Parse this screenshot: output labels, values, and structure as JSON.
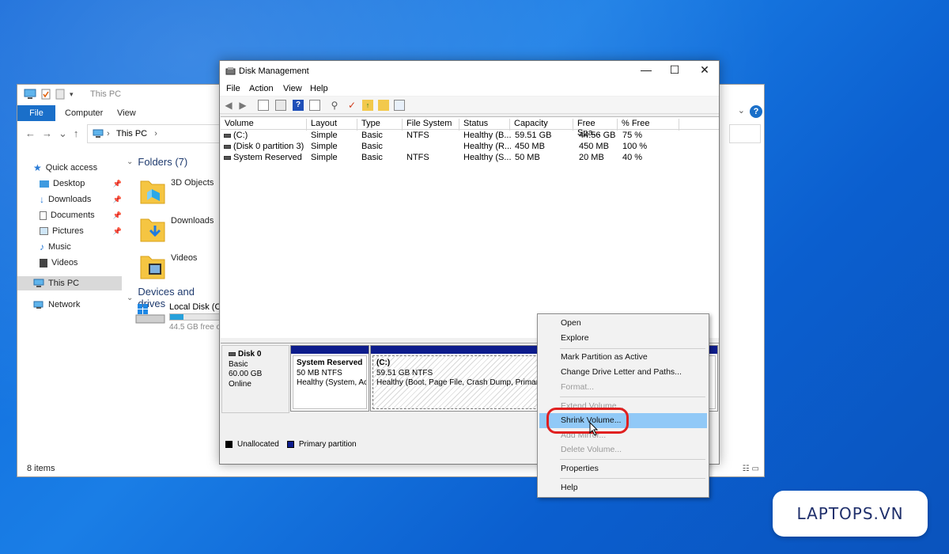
{
  "explorer": {
    "title": "This PC",
    "ribbon_tabs": [
      "File",
      "Computer",
      "View"
    ],
    "address": "This PC",
    "sidebar": [
      {
        "label": "Quick access",
        "icon": "star-icon"
      },
      {
        "label": "Desktop",
        "icon": "desktop-folder-icon"
      },
      {
        "label": "Downloads",
        "icon": "download-arrow-icon"
      },
      {
        "label": "Documents",
        "icon": "documents-icon"
      },
      {
        "label": "Pictures",
        "icon": "pictures-icon"
      },
      {
        "label": "Music",
        "icon": "music-note-icon"
      },
      {
        "label": "Videos",
        "icon": "videos-icon"
      },
      {
        "label": "This PC",
        "icon": "computer-icon"
      },
      {
        "label": "Network",
        "icon": "network-icon"
      }
    ],
    "folders_header": "Folders (7)",
    "folders": [
      "3D Objects",
      "Downloads",
      "Videos"
    ],
    "devices_header": "Devices and drives",
    "drive": {
      "label": "Local Disk (C:",
      "free": "44.5 GB free o",
      "used_fraction": 0.25
    },
    "status": "8 items"
  },
  "disk_mgmt": {
    "title": "Disk Management",
    "menu": [
      "File",
      "Action",
      "View",
      "Help"
    ],
    "columns": [
      "Volume",
      "Layout",
      "Type",
      "File System",
      "Status",
      "Capacity",
      "Free Spa...",
      "% Free"
    ],
    "rows": [
      {
        "volume": "(C:)",
        "layout": "Simple",
        "type": "Basic",
        "fs": "NTFS",
        "status": "Healthy (B...",
        "capacity": "59.51 GB",
        "free": "44.56 GB",
        "pct": "75 %"
      },
      {
        "volume": "(Disk 0 partition 3)",
        "layout": "Simple",
        "type": "Basic",
        "fs": "",
        "status": "Healthy (R...",
        "capacity": "450 MB",
        "free": "450 MB",
        "pct": "100 %"
      },
      {
        "volume": "System Reserved",
        "layout": "Simple",
        "type": "Basic",
        "fs": "NTFS",
        "status": "Healthy (S...",
        "capacity": "50 MB",
        "free": "20 MB",
        "pct": "40 %"
      }
    ],
    "disk": {
      "name": "Disk 0",
      "type": "Basic",
      "size": "60.00 GB",
      "state": "Online"
    },
    "partitions": [
      {
        "name": "System Reserved",
        "size": "50 MB NTFS",
        "status": "Healthy (System, Ac"
      },
      {
        "name": "(C:)",
        "size": "59.51 GB NTFS",
        "status": "Healthy (Boot, Page File, Crash Dump, Primary"
      }
    ],
    "legend": [
      "Unallocated",
      "Primary partition"
    ],
    "colors": {
      "primary": "#0d1c8c",
      "unallocated": "#000000"
    }
  },
  "context_menu": {
    "items": [
      {
        "label": "Open",
        "enabled": true
      },
      {
        "label": "Explore",
        "enabled": true
      },
      {
        "label": "Mark Partition as Active",
        "enabled": true
      },
      {
        "label": "Change Drive Letter and Paths...",
        "enabled": true
      },
      {
        "label": "Format...",
        "enabled": false
      },
      {
        "label": "Extend Volume...",
        "enabled": false
      },
      {
        "label": "Shrink Volume...",
        "enabled": true,
        "highlighted": true
      },
      {
        "label": "Add Mirror...",
        "enabled": false
      },
      {
        "label": "Delete Volume...",
        "enabled": false
      },
      {
        "label": "Properties",
        "enabled": true
      },
      {
        "label": "Help",
        "enabled": true
      }
    ]
  },
  "brand": "LAPTOPS.VN"
}
